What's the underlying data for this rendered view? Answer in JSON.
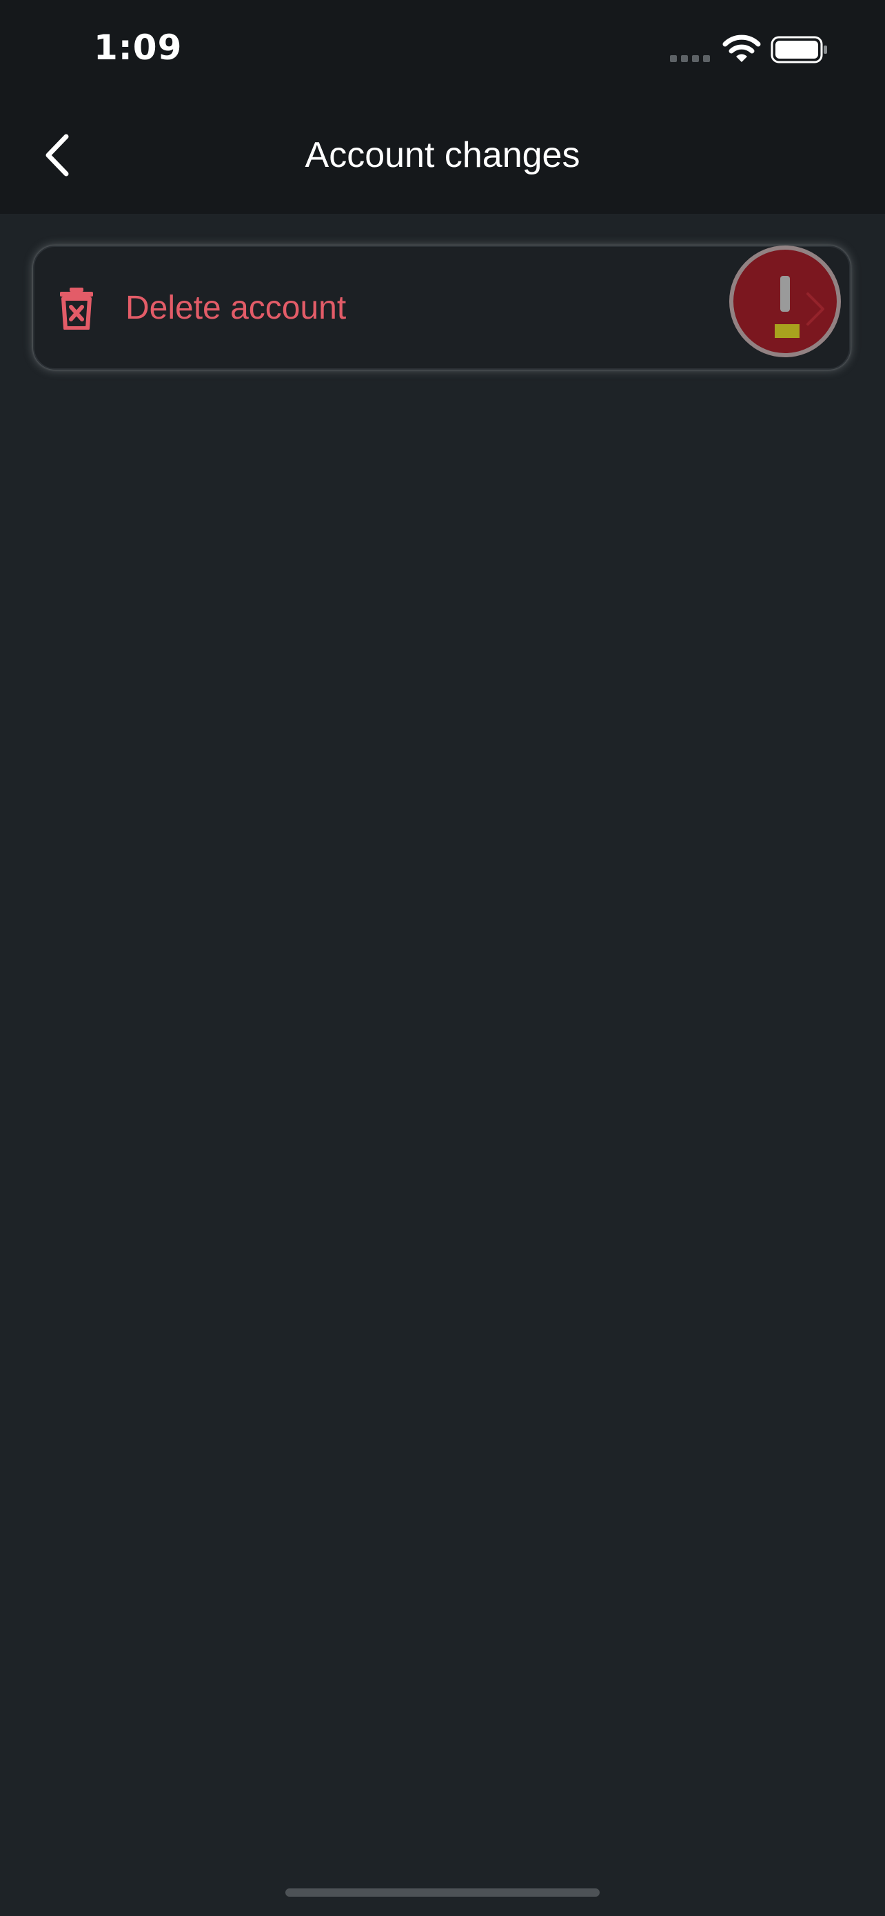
{
  "status_bar": {
    "time": "1:09",
    "signal_icon": "signal-icon",
    "wifi_icon": "wifi-icon",
    "battery_icon": "battery-icon"
  },
  "nav": {
    "title": "Account changes",
    "back_icon": "chevron-left-icon"
  },
  "settings": {
    "items": [
      {
        "label": "Delete account",
        "icon": "trash-icon",
        "trailing_icon": "chevron-right-icon"
      }
    ]
  },
  "overlay": {
    "icon": "alert-badge-icon"
  },
  "colors": {
    "background": "#1e2327",
    "header": "#15181b",
    "destructive": "#e35c68",
    "text": "#ffffff"
  }
}
